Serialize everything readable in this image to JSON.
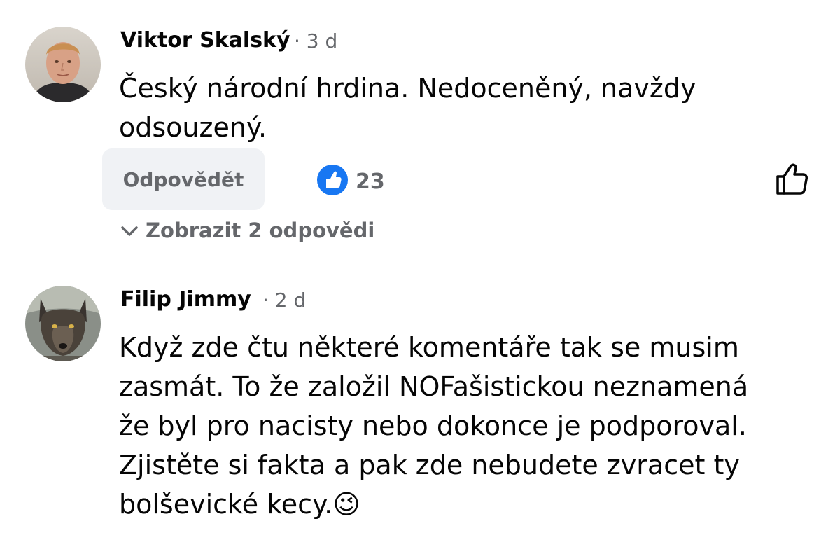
{
  "comments": [
    {
      "author": "Viktor Skalský",
      "time": "· 3 d",
      "text_lines": [
        "Český národní hrdina. Nedoceněný, navždy",
        "odsouzený."
      ],
      "reply_label": "Odpovědět",
      "reaction_count": "23",
      "reaction_icon": "like-badge-icon",
      "like_icon": "thumbs-up-outline-icon",
      "show_replies_label": "Zobrazit 2 odpovědi",
      "show_replies_icon": "chevron-down-icon"
    },
    {
      "author": "Filip Jimmy",
      "time": "· 2 d",
      "text_lines": [
        "Když zde čtu některé komentáře tak se musim",
        "zasmát. To že založil NOFašistickou neznamená",
        "že byl pro nacisty nebo dokonce je podporoval.",
        "Zjistěte si fakta a pak zde nebudete zvracet ty",
        "bolševické kecy."
      ],
      "emoji": "😉"
    }
  ],
  "colors": {
    "primary_text": "#050505",
    "secondary_text": "#65676b",
    "like_blue": "#1877f2",
    "button_bg": "#f0f2f5"
  }
}
